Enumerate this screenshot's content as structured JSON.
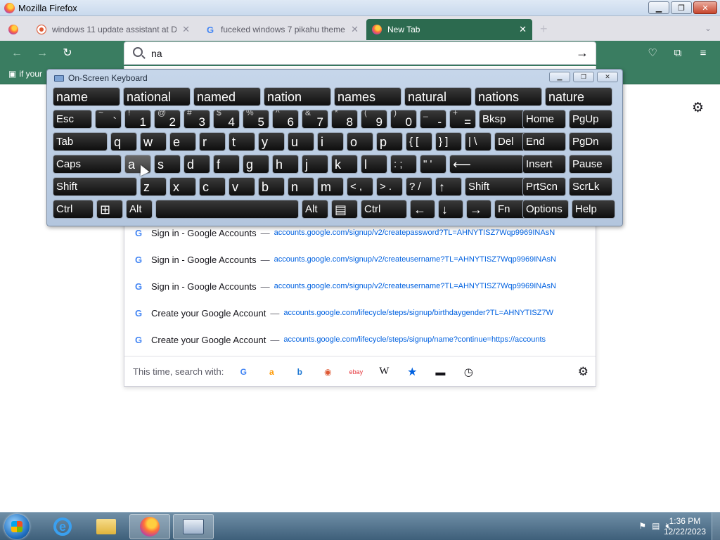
{
  "window": {
    "title": "Mozilla Firefox",
    "minimize_label": "▁",
    "maximize_label": "❐",
    "close_label": "✕"
  },
  "tabs": [
    {
      "label": "windows 11 update assistant at D",
      "favicon": "duckduckgo-icon",
      "active": false
    },
    {
      "label": "fuceked windows 7 pikahu theme",
      "favicon": "google-icon",
      "active": false
    },
    {
      "label": "New Tab",
      "favicon": "firefox-icon",
      "active": true
    }
  ],
  "toolbar": {
    "url_value": "na",
    "bookmark_text": "if your"
  },
  "suggestions": [
    {
      "title": "Sign in - Google Accounts",
      "url": "accounts.google.com/signup/v2/createpassword?TL=AHNYTISZ7Wqp9969INAsN"
    },
    {
      "title": "Sign in - Google Accounts",
      "url": "accounts.google.com/signup/v2/createusername?TL=AHNYTISZ7Wqp9969INAsN"
    },
    {
      "title": "Sign in - Google Accounts",
      "url": "accounts.google.com/signup/v2/createusername?TL=AHNYTISZ7Wqp9969INAsN"
    },
    {
      "title": "Create your Google Account",
      "url": "accounts.google.com/lifecycle/steps/signup/birthdaygender?TL=AHNYTISZ7W"
    },
    {
      "title": "Create your Google Account",
      "url": "accounts.google.com/lifecycle/steps/signup/name?continue=https://accounts"
    }
  ],
  "search_engines": {
    "label": "This time, search with:",
    "icons": [
      "google-icon",
      "amazon-icon",
      "bing-icon",
      "duckduckgo-icon",
      "ebay-icon",
      "wikipedia-icon",
      "bookmarks-star-icon",
      "tabs-icon",
      "history-icon"
    ],
    "ebay_text": "ebay",
    "wiki_text": "W"
  },
  "osk": {
    "title": "On-Screen Keyboard",
    "predictions": [
      "name",
      "national",
      "named",
      "nation",
      "names",
      "natural",
      "nations",
      "nature"
    ],
    "row1": [
      {
        "main": "Esc"
      },
      {
        "sym": "~",
        "main": "`"
      },
      {
        "sym": "!",
        "main": "1"
      },
      {
        "sym": "@",
        "main": "2"
      },
      {
        "sym": "#",
        "main": "3"
      },
      {
        "sym": "$",
        "main": "4"
      },
      {
        "sym": "%",
        "main": "5"
      },
      {
        "sym": "^",
        "main": "6"
      },
      {
        "sym": "&",
        "main": "7"
      },
      {
        "sym": "*",
        "main": "8"
      },
      {
        "sym": "(",
        "main": "9"
      },
      {
        "sym": ")",
        "main": "0"
      },
      {
        "sym": "_",
        "main": "-"
      },
      {
        "sym": "+",
        "main": "="
      },
      {
        "main": "Bksp"
      },
      {
        "main": "Home"
      },
      {
        "main": "PgUp"
      }
    ],
    "row2": [
      "Tab",
      "q",
      "w",
      "e",
      "r",
      "t",
      "y",
      "u",
      "i",
      "o",
      "p",
      "{ [",
      "} ]",
      "| \\",
      "Del",
      "End",
      "PgDn"
    ],
    "row3": [
      "Caps",
      "a",
      "s",
      "d",
      "f",
      "g",
      "h",
      "j",
      "k",
      "l",
      ": ;",
      "\" '",
      "⟵",
      "Insert",
      "Pause"
    ],
    "row4": [
      "Shift",
      "z",
      "x",
      "c",
      "v",
      "b",
      "n",
      "m",
      "< ,",
      "> .",
      "? /",
      "↑",
      "Shift",
      "PrtScn",
      "ScrLk"
    ],
    "row5": [
      "Ctrl",
      "⊞",
      "Alt",
      "",
      "Alt",
      "▤",
      "Ctrl",
      "←",
      "↓",
      "→",
      "Fn",
      "Options",
      "Help"
    ]
  },
  "taskbar": {
    "time": "1:36 PM",
    "date": "12/22/2023"
  }
}
